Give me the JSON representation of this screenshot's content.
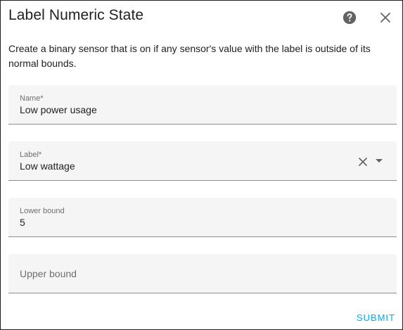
{
  "dialog": {
    "title": "Label Numeric State",
    "help_icon": "help-circle-icon",
    "close_icon": "close-icon",
    "description": "Create a binary sensor that is on if any sensor's value with the label is outside of its normal bounds."
  },
  "form": {
    "name": {
      "label": "Name*",
      "value": "Low power usage"
    },
    "label_select": {
      "label": "Label*",
      "value": "Low wattage",
      "clear_icon": "close-icon",
      "dropdown_icon": "menu-down-icon"
    },
    "lower_bound": {
      "label": "Lower bound",
      "value": "5"
    },
    "upper_bound": {
      "placeholder": "Upper bound"
    }
  },
  "actions": {
    "submit_label": "SUBMIT"
  },
  "colors": {
    "accent": "#03a9f4",
    "field_bg": "#f5f5f5",
    "text": "#212121",
    "secondary_text": "#6f6f6f",
    "icon": "#636363"
  }
}
